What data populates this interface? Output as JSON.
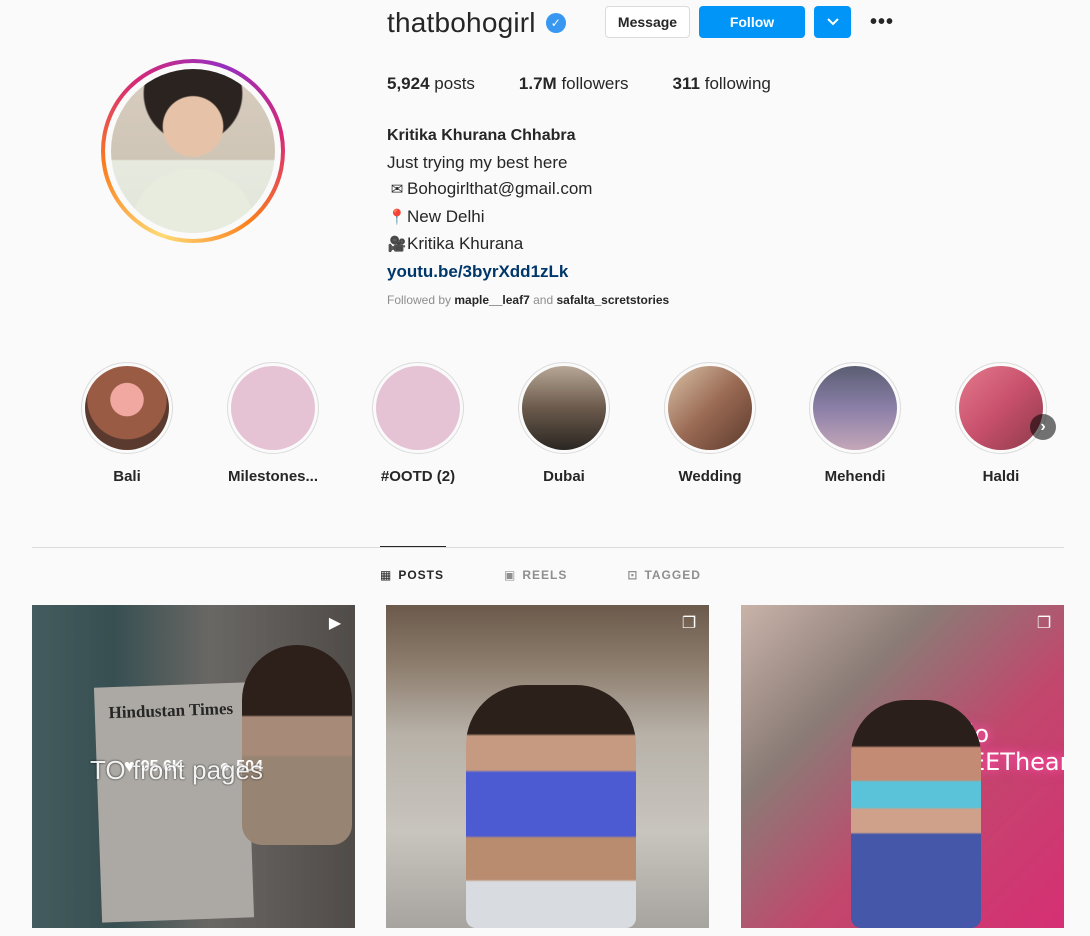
{
  "profile": {
    "username": "thatbohogirl",
    "verified_icon": "verified-badge-icon",
    "actions": {
      "message": "Message",
      "follow": "Follow",
      "dropdown_icon": "chevron-down-icon",
      "more_icon": "more-options-icon"
    },
    "stats": {
      "posts_count": "5,924",
      "posts_label": "posts",
      "followers_count": "1.7M",
      "followers_label": "followers",
      "following_count": "311",
      "following_label": "following"
    },
    "full_name": "Kritika Khurana Chhabra",
    "bio_lines": [
      "Just trying my best here",
      "Bohogirlthat@gmail.com",
      "New Delhi",
      "Kritika Khurana"
    ],
    "bio_icons": [
      "",
      "envelope-heart-icon",
      "location-pin-icon",
      "camera-icon"
    ],
    "link": "youtu.be/3byrXdd1zLk",
    "followed_by": {
      "prefix": "Followed by",
      "user1": "maple__leaf7",
      "joiner": "and",
      "user2": "safalta_scretstories"
    }
  },
  "highlights": [
    {
      "label": "Bali",
      "color": "#b9735a"
    },
    {
      "label": "Milestones...",
      "color": "#e5c3d4"
    },
    {
      "label": "#OOTD (2)",
      "color": "#e5c3d4"
    },
    {
      "label": "Dubai",
      "color": "#8c7a6a"
    },
    {
      "label": "Wedding",
      "color": "#9a6a54"
    },
    {
      "label": "Mehendi",
      "color": "#6d6a8c"
    },
    {
      "label": "Haldi",
      "color": "#c8506c"
    }
  ],
  "tabs": [
    {
      "label": "POSTS",
      "icon": "grid-icon",
      "active": true
    },
    {
      "label": "REELS",
      "icon": "reels-icon",
      "active": false
    },
    {
      "label": "TAGGED",
      "icon": "tagged-icon",
      "active": false
    }
  ],
  "posts": [
    {
      "type_icon": "reel-icon",
      "likes": "95.6K",
      "comments": "504",
      "image_text": "Hindustan Times",
      "caption_overlay": "TO front pages"
    },
    {
      "type_icon": "carousel-icon"
    },
    {
      "type_icon": "carousel-icon",
      "neon_text": "hello SWEETheart."
    }
  ]
}
